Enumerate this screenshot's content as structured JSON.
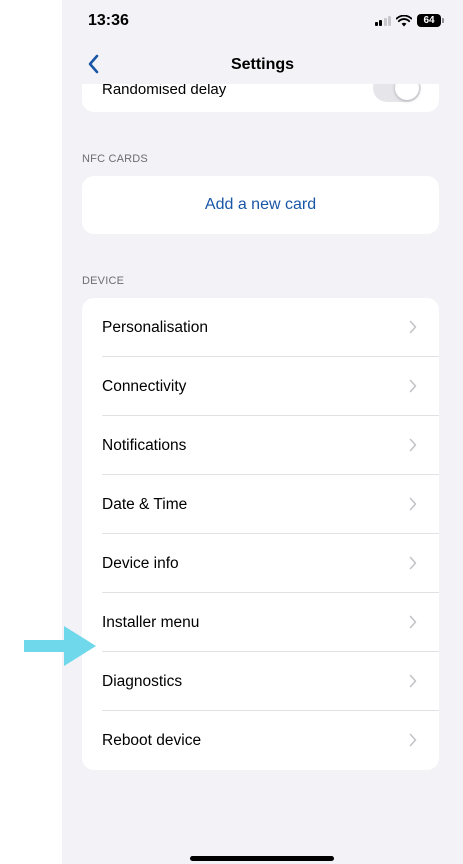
{
  "status_bar": {
    "time": "13:36",
    "battery": "64"
  },
  "nav": {
    "title": "Settings"
  },
  "clipped_row": {
    "label": "Randomised delay",
    "toggle_on": false
  },
  "nfc": {
    "header": "NFC CARDS",
    "add_card": "Add a new card"
  },
  "device": {
    "header": "DEVICE",
    "items": [
      {
        "label": "Personalisation"
      },
      {
        "label": "Connectivity"
      },
      {
        "label": "Notifications"
      },
      {
        "label": "Date & Time"
      },
      {
        "label": "Device info"
      },
      {
        "label": "Installer menu"
      },
      {
        "label": "Diagnostics"
      },
      {
        "label": "Reboot device"
      }
    ]
  },
  "colors": {
    "accent": "#1a56a6",
    "arrow": "#6fd8ea",
    "background": "#f2f2f7"
  }
}
